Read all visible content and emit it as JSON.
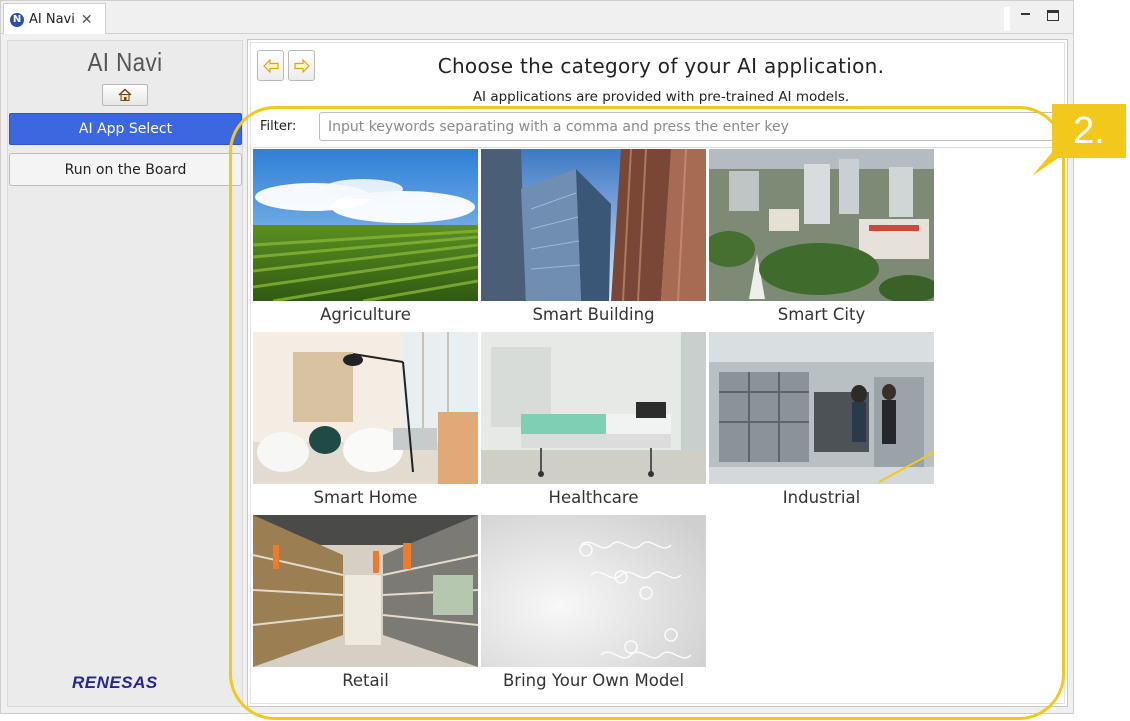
{
  "tab": {
    "title": "AI Navi",
    "icon": "renesas-logo-icon",
    "close_glyph": "✕"
  },
  "sidebar": {
    "app_title": "AI Navi",
    "home_icon": "home-icon",
    "items": [
      {
        "label": "AI App Select",
        "selected": true
      },
      {
        "label": "Run on the Board",
        "selected": false
      }
    ],
    "logo_text": "RENESAS"
  },
  "main": {
    "back_icon": "arrow-left-icon",
    "forward_icon": "arrow-right-icon",
    "heading": "Choose the category of your AI application.",
    "subheading": "AI applications are provided with pre-trained AI models.",
    "filter": {
      "label": "Filter:",
      "value": "",
      "placeholder": "Input keywords separating with a comma and press the enter key"
    },
    "categories": [
      {
        "label": "Agriculture",
        "image": "agriculture-field-photo"
      },
      {
        "label": "Smart Building",
        "image": "skyscrapers-photo"
      },
      {
        "label": "Smart City",
        "image": "city-aerial-photo"
      },
      {
        "label": "Smart Home",
        "image": "living-room-photo"
      },
      {
        "label": "Healthcare",
        "image": "hospital-bed-photo"
      },
      {
        "label": "Industrial",
        "image": "factory-line-photo"
      },
      {
        "label": "Retail",
        "image": "store-aisle-photo"
      },
      {
        "label": "Bring Your Own Model",
        "image": "abstract-pattern-photo"
      }
    ]
  },
  "callout": {
    "label": "2.",
    "color": "#f2c81c"
  },
  "colors": {
    "accent": "#3d67e0",
    "brand": "#27288a"
  }
}
